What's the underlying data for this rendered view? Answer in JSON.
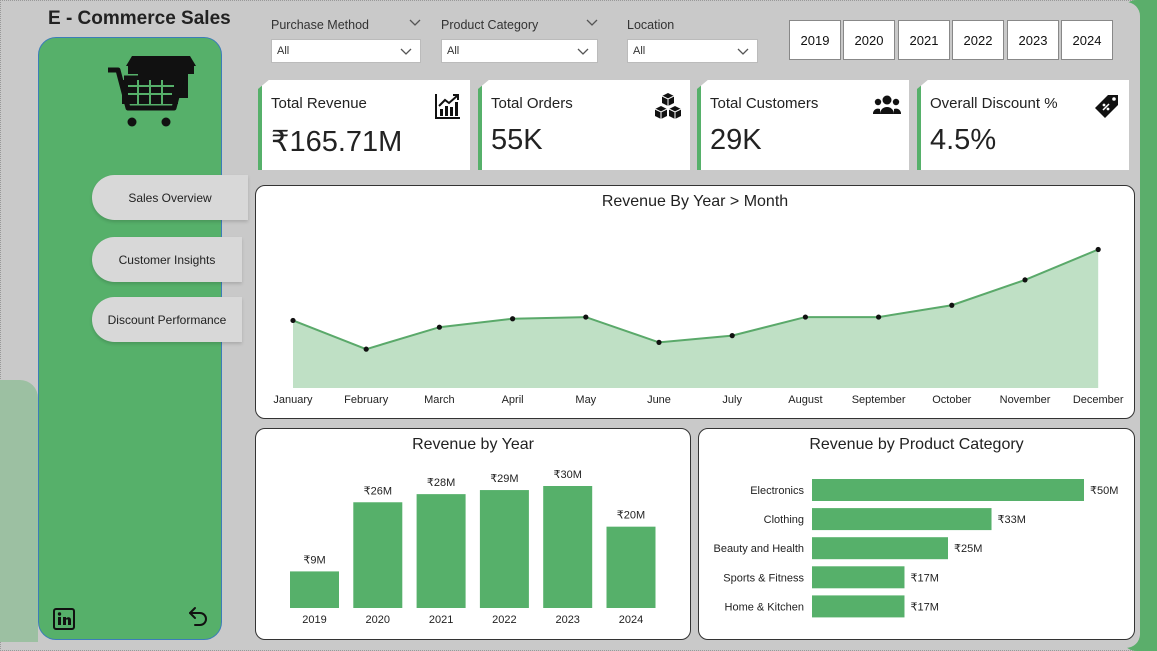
{
  "app": {
    "title": "E - Commerce Sales"
  },
  "nav": [
    {
      "label": "Sales Overview"
    },
    {
      "label": "Customer Insights"
    },
    {
      "label": "Discount Performance"
    }
  ],
  "slicers": [
    {
      "label": "Purchase Method",
      "value": "All"
    },
    {
      "label": "Product Category",
      "value": "All"
    },
    {
      "label": "Location",
      "value": "All"
    }
  ],
  "years": [
    "2019",
    "2020",
    "2021",
    "2022",
    "2023",
    "2024"
  ],
  "kpis": [
    {
      "title": "Total Revenue",
      "value": "₹165.71M",
      "icon": "chart-up-icon"
    },
    {
      "title": "Total Orders",
      "value": "55K",
      "icon": "boxes-icon"
    },
    {
      "title": "Total Customers",
      "value": "29K",
      "icon": "users-icon"
    },
    {
      "title": "Overall Discount %",
      "value": "4.5%",
      "icon": "price-tag-icon"
    }
  ],
  "colors": {
    "accent": "#56b06a",
    "area": "#bfe0c5",
    "line": "#5aa96a",
    "background": "#c9c9c9"
  },
  "chart_data": [
    {
      "type": "area",
      "title": "Revenue By Year > Month",
      "categories": [
        "January",
        "February",
        "March",
        "April",
        "May",
        "June",
        "July",
        "August",
        "September",
        "October",
        "November",
        "December"
      ],
      "values": [
        13.0,
        11.3,
        12.6,
        13.1,
        13.2,
        11.7,
        12.1,
        13.2,
        13.2,
        13.9,
        15.4,
        17.2
      ],
      "ylim": [
        9,
        18
      ],
      "grid": false
    },
    {
      "type": "bar",
      "title": "Revenue by Year",
      "categories": [
        "2019",
        "2020",
        "2021",
        "2022",
        "2023",
        "2024"
      ],
      "values": [
        9,
        26,
        28,
        29,
        30,
        20
      ],
      "labels": [
        "₹9M",
        "₹26M",
        "₹28M",
        "₹29M",
        "₹30M",
        "₹20M"
      ],
      "ylim": [
        0,
        30
      ]
    },
    {
      "type": "bar",
      "orientation": "horizontal",
      "title": "Revenue by Product Category",
      "categories": [
        "Electronics",
        "Clothing",
        "Beauty and Health",
        "Sports & Fitness",
        "Home & Kitchen"
      ],
      "values": [
        50,
        33,
        25,
        17,
        17
      ],
      "labels": [
        "₹50M",
        "₹33M",
        "₹25M",
        "₹17M",
        "₹17M"
      ],
      "xlim": [
        0,
        50
      ]
    }
  ]
}
